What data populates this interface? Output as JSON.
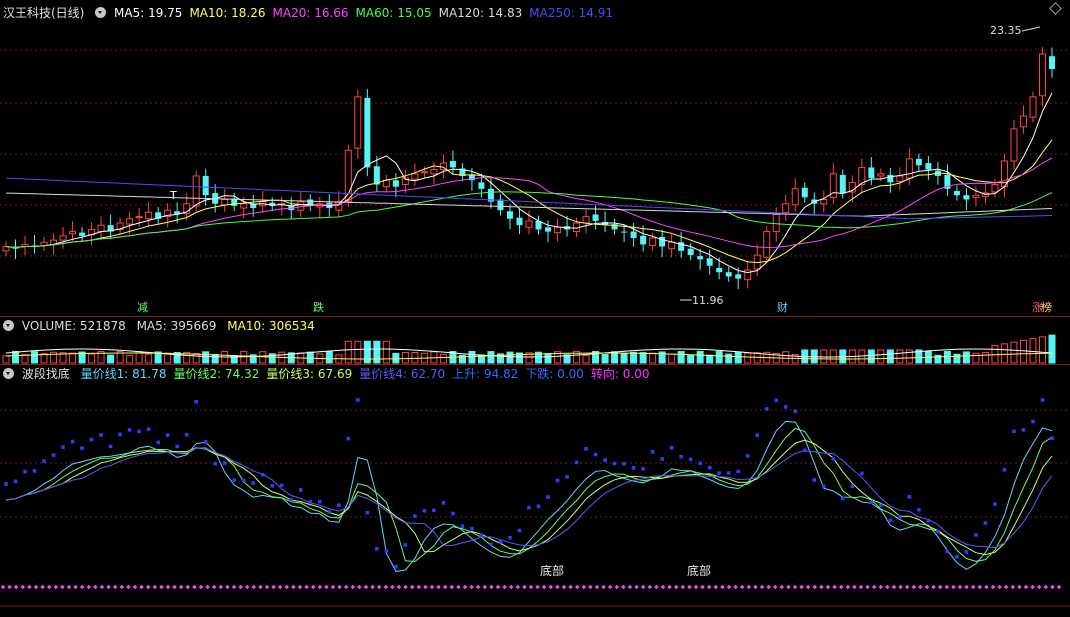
{
  "stock": {
    "title": "汉王科技(日线)",
    "ma": [
      {
        "label": "MA5: 19.75",
        "color": "#ffffff"
      },
      {
        "label": "MA10: 18.26",
        "color": "#ffff55"
      },
      {
        "label": "MA20: 16.66",
        "color": "#ff44ff"
      },
      {
        "label": "MA60: 15.05",
        "color": "#44ff44"
      },
      {
        "label": "MA120: 14.83",
        "color": "#d8d8d8"
      },
      {
        "label": "MA250: 14.91",
        "color": "#4a4aff"
      }
    ],
    "high_label": "23.35",
    "low_label": "11.96",
    "markers": [
      {
        "text": "T",
        "color": "#ffffff"
      },
      {
        "text": "减",
        "color": "#66ff66"
      },
      {
        "text": "跌",
        "color": "#66ff66"
      },
      {
        "text": "财",
        "color": "#66ccff"
      },
      {
        "text": "涨",
        "color": "#ff6666"
      },
      {
        "text": "榜",
        "color": "#ffdd44"
      }
    ]
  },
  "volume": {
    "label": "VOLUME: 521878",
    "ma5": "MA5: 395669",
    "ma10": "MA10: 306534"
  },
  "indicator": {
    "title": "波段找底",
    "lines": [
      {
        "label": "量价线1: 81.78",
        "color": "#5fd7ff"
      },
      {
        "label": "量价线2: 74.32",
        "color": "#66ff66"
      },
      {
        "label": "量价线3: 67.69",
        "color": "#c8ff66"
      },
      {
        "label": "量价线4: 62.70",
        "color": "#5a5aff"
      },
      {
        "label": "上升: 94.82",
        "color": "#2f6bff"
      },
      {
        "label": "下跌: 0.00",
        "color": "#2f6bff"
      },
      {
        "label": "转向: 0.00",
        "color": "#ff33ff"
      }
    ],
    "bottom_labels": [
      "底部",
      "底部"
    ]
  },
  "chart_data": {
    "type": "candlestick",
    "close_prices": [
      13.5,
      13.4,
      13.6,
      13.5,
      13.7,
      13.8,
      14.0,
      14.2,
      14.0,
      14.3,
      14.5,
      14.2,
      14.6,
      14.8,
      14.9,
      15.1,
      14.8,
      15.2,
      15.0,
      15.5,
      16.8,
      15.9,
      15.5,
      15.7,
      15.4,
      15.5,
      15.3,
      15.6,
      15.4,
      15.5,
      15.2,
      15.6,
      15.4,
      15.5,
      15.3,
      15.6,
      18.0,
      20.5,
      17.2,
      16.4,
      16.6,
      16.3,
      16.7,
      16.9,
      17.0,
      17.1,
      17.4,
      17.2,
      16.8,
      16.6,
      16.2,
      15.6,
      15.2,
      14.8,
      14.5,
      14.7,
      14.3,
      14.2,
      14.4,
      14.3,
      14.6,
      14.9,
      14.7,
      14.5,
      14.3,
      14.2,
      13.9,
      13.6,
      13.9,
      13.5,
      13.7,
      13.3,
      13.1,
      12.9,
      12.6,
      12.3,
      12.1,
      12.0,
      12.4,
      13.1,
      14.2,
      15.0,
      15.5,
      16.2,
      15.8,
      15.5,
      15.7,
      16.9,
      16.0,
      16.5,
      17.2,
      16.7,
      16.9,
      16.5,
      16.8,
      17.6,
      17.3,
      17.1,
      16.8,
      16.2,
      15.9,
      15.7,
      15.9,
      16.0,
      16.4,
      17.5,
      19.0,
      19.6,
      20.5,
      22.5,
      21.8
    ],
    "high": 23.35,
    "low": 11.96,
    "moving_averages": {
      "MA5": 19.75,
      "MA10": 18.26,
      "MA20": 16.66,
      "MA60": 15.05,
      "MA120": 14.83,
      "MA250": 14.91
    },
    "volume": {
      "VOLUME": 521878,
      "MA5": 395669,
      "MA10": 306534
    },
    "indicator": {
      "量价线1": 81.78,
      "量价线2": 74.32,
      "量价线3": 67.69,
      "量价线4": 62.7,
      "上升": 94.82,
      "下跌": 0.0,
      "转向": 0.0
    }
  }
}
